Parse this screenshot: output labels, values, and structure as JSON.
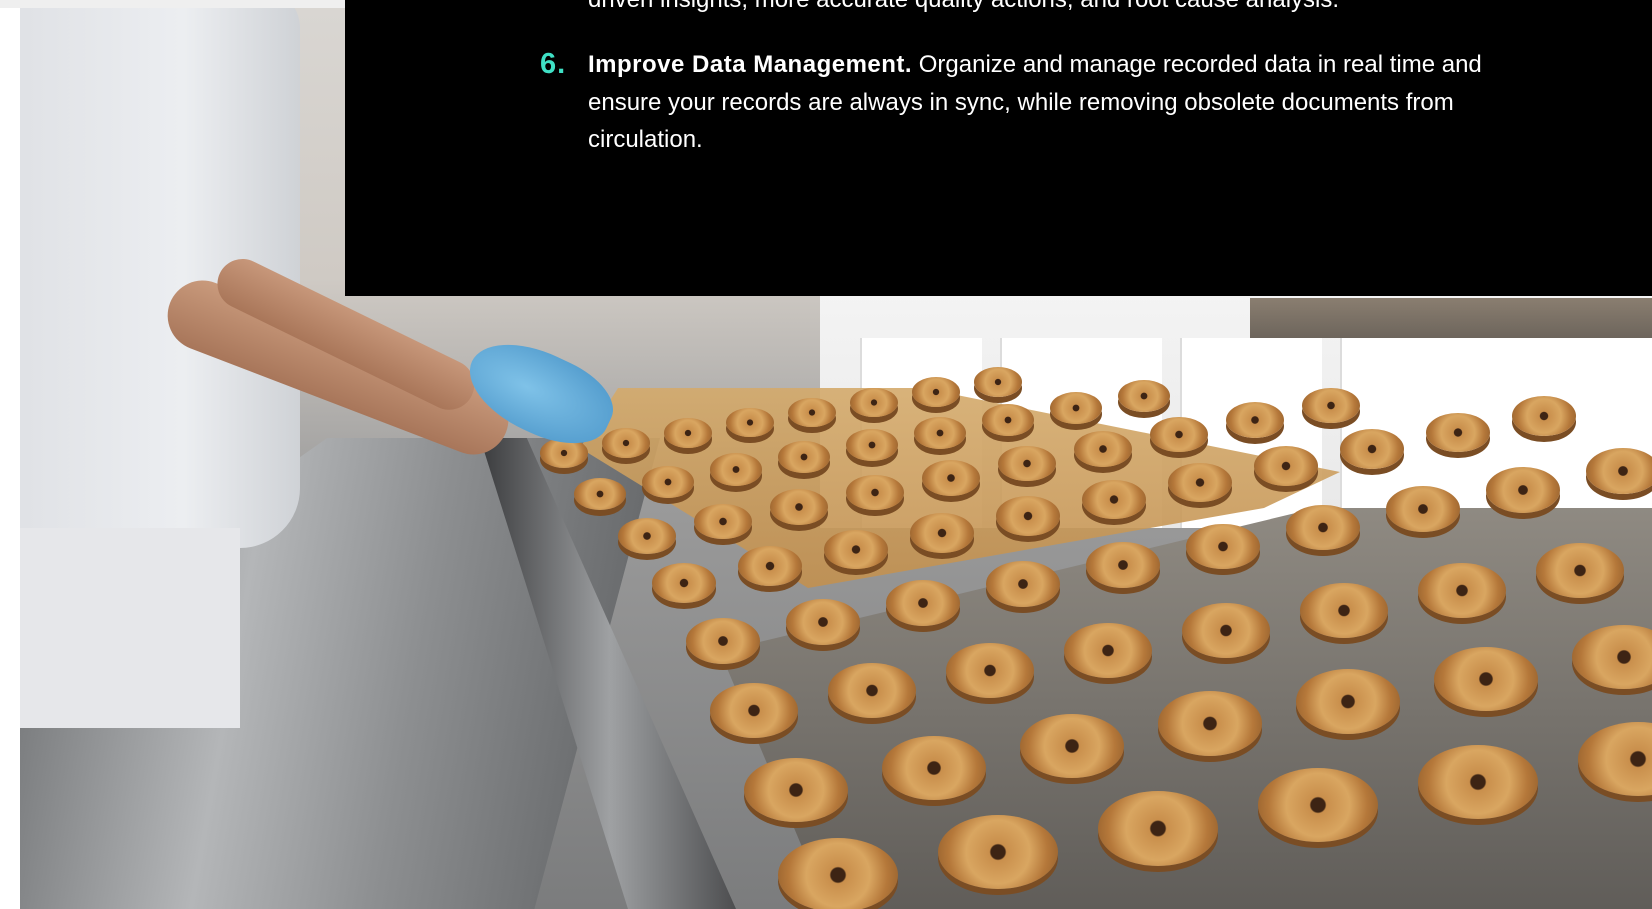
{
  "overlay": {
    "previous_item_tail": "driven insights, more accurate quality actions, and root cause analysis.",
    "item": {
      "number": "6.",
      "title": "Improve Data Management.",
      "text": " Organize and manage recorded data in real time and ensure your records are always in sync, while removing obsolete documents from circulation."
    }
  },
  "colors": {
    "panel_background": "#000000",
    "number_accent": "#3fe0c5",
    "text": "#ffffff"
  },
  "image": {
    "description_icon": "photo-image"
  }
}
